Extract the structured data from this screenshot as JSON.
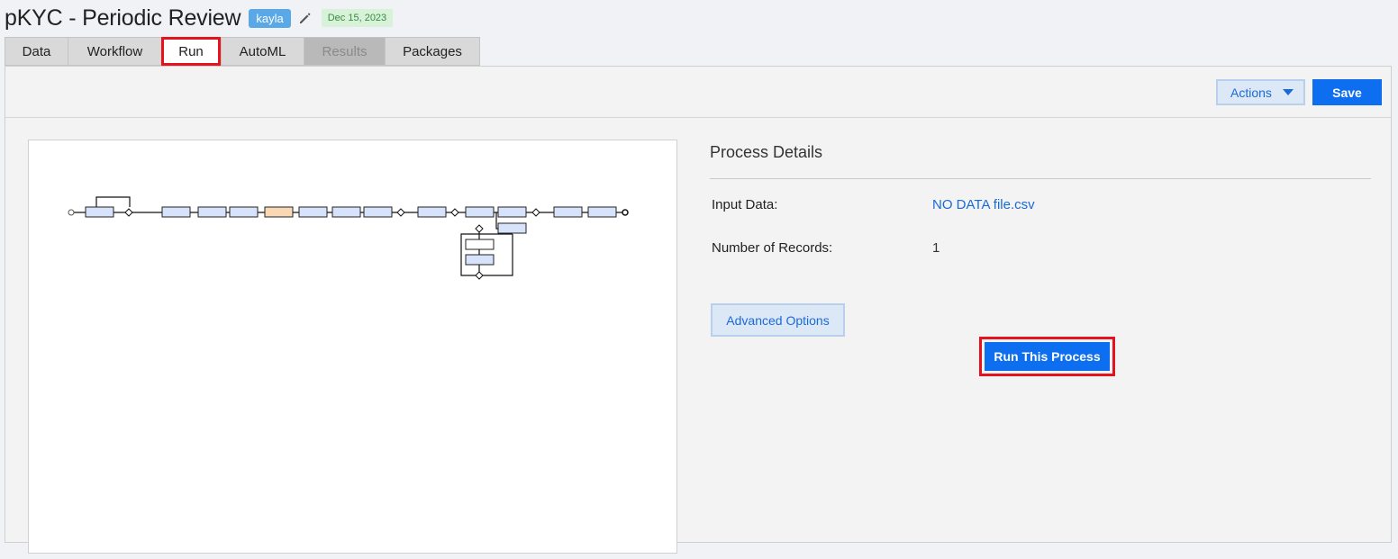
{
  "header": {
    "title": "pKYC - Periodic Review",
    "user_badge": "kayla",
    "date_badge": "Dec 15, 2023"
  },
  "tabs": [
    {
      "label": "Data"
    },
    {
      "label": "Workflow"
    },
    {
      "label": "Run",
      "active": true
    },
    {
      "label": "AutoML"
    },
    {
      "label": "Results",
      "disabled": true
    },
    {
      "label": "Packages"
    }
  ],
  "toolbar": {
    "actions_label": "Actions",
    "save_label": "Save"
  },
  "details": {
    "title": "Process Details",
    "input_data_label": "Input Data:",
    "input_data_value": "NO DATA file.csv",
    "records_label": "Number of Records:",
    "records_value": "1",
    "advanced_label": "Advanced Options",
    "run_label": "Run This Process"
  },
  "colors": {
    "accent": "#0d6ef0",
    "highlight": "#e3141d",
    "link": "#1a6ad6"
  }
}
